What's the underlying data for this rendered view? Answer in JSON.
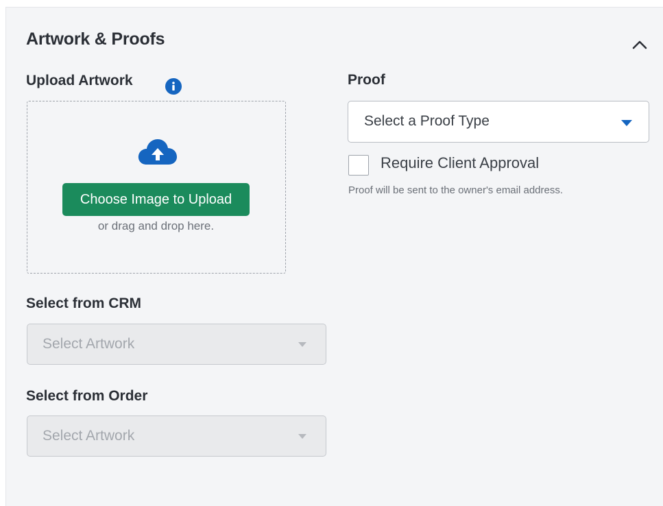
{
  "section": {
    "title": "Artwork & Proofs",
    "collapse_icon": "chevron-up-icon"
  },
  "upload": {
    "label": "Upload Artwork",
    "info_icon": "info-icon",
    "cloud_icon": "cloud-upload-icon",
    "button_label": "Choose Image to Upload",
    "drag_text": "or drag and drop here."
  },
  "crm": {
    "label": "Select from CRM",
    "placeholder": "Select Artwork"
  },
  "order": {
    "label": "Select from Order",
    "placeholder": "Select Artwork"
  },
  "proof": {
    "label": "Proof",
    "placeholder": "Select a Proof Type",
    "checkbox_label": "Require Client Approval",
    "checkbox_checked": false,
    "helper_text": "Proof will be sent to the owner's email address."
  },
  "colors": {
    "primary_blue": "#1565c0",
    "upload_green": "#1b8b5c",
    "panel_bg": "#f4f5f7"
  }
}
